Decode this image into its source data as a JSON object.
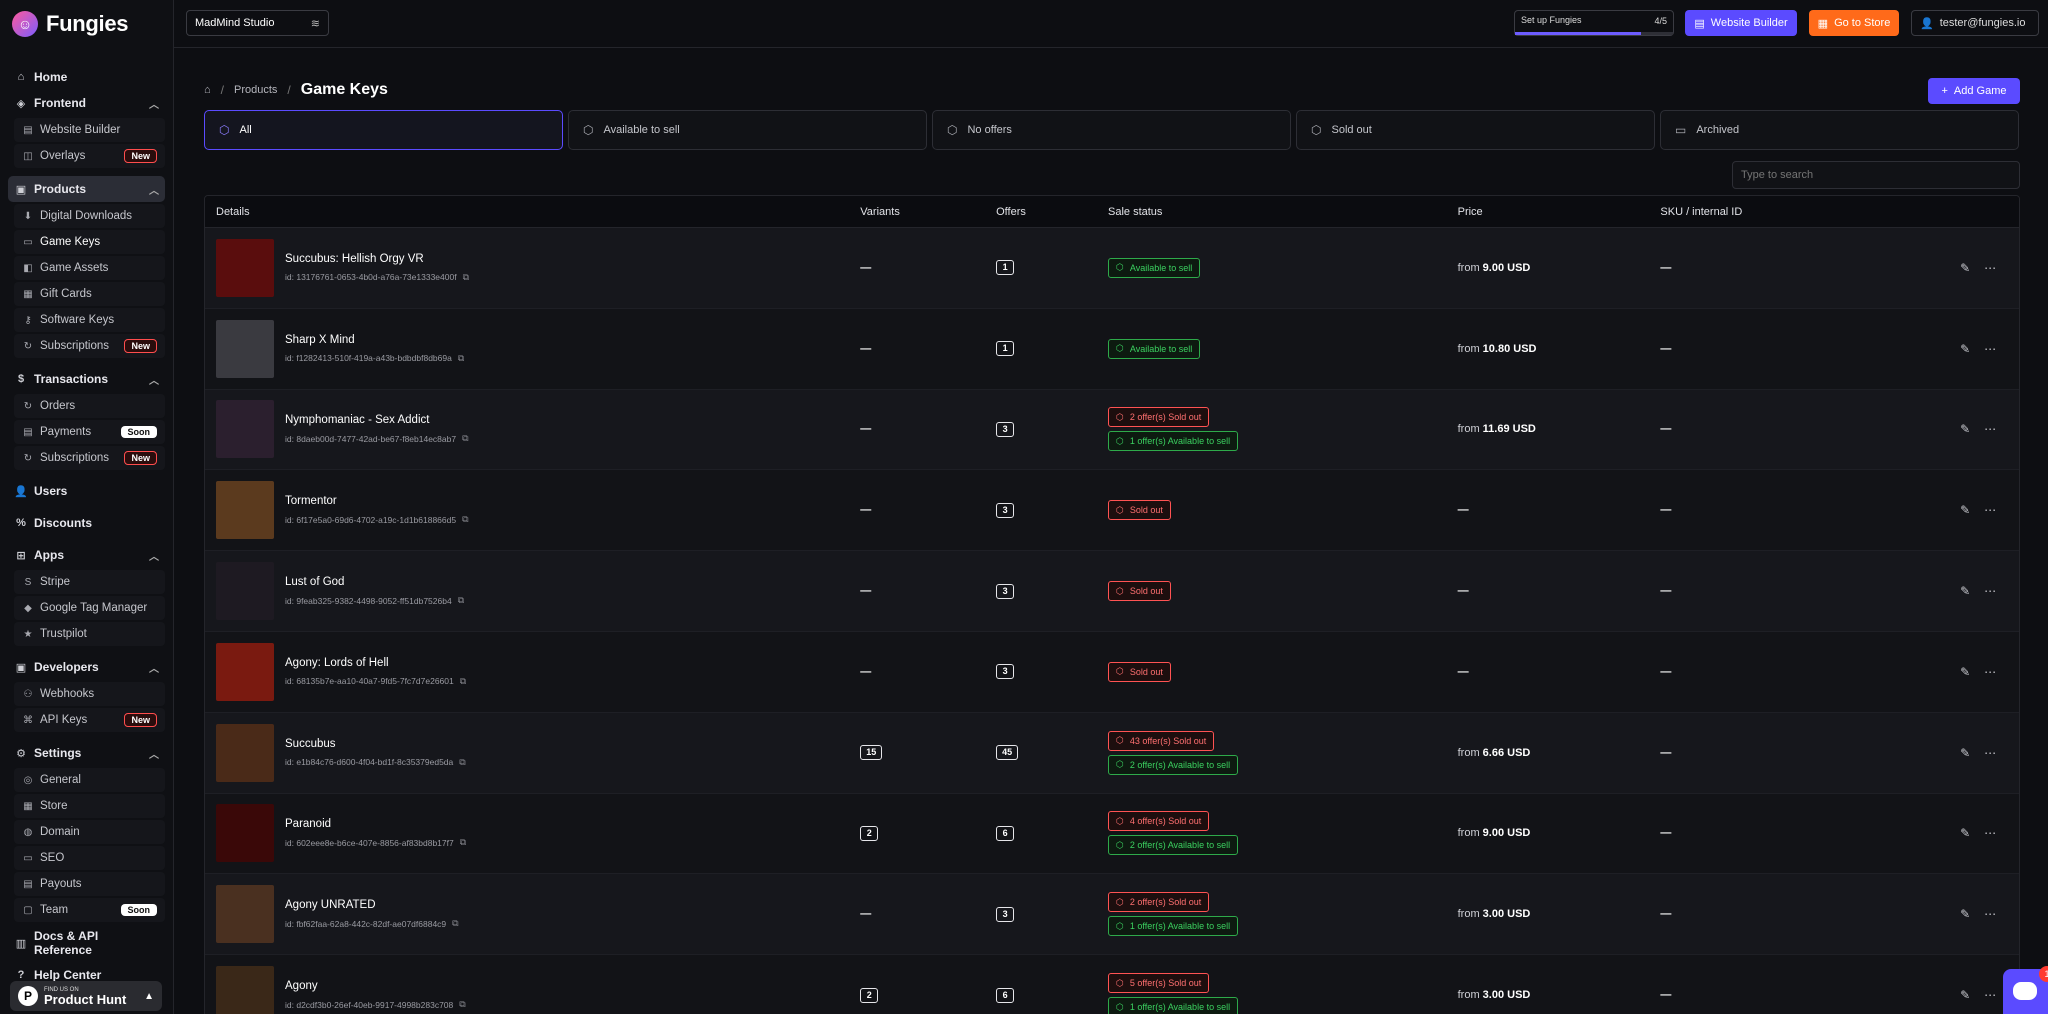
{
  "app": {
    "logo_text": "Fungies"
  },
  "sidebar": {
    "home": "Home",
    "frontend": {
      "label": "Frontend",
      "items": [
        {
          "label": "Website Builder"
        },
        {
          "label": "Overlays",
          "badge": "New"
        }
      ]
    },
    "products": {
      "label": "Products",
      "items": [
        {
          "label": "Digital Downloads"
        },
        {
          "label": "Game Keys"
        },
        {
          "label": "Game Assets"
        },
        {
          "label": "Gift Cards"
        },
        {
          "label": "Software Keys"
        },
        {
          "label": "Subscriptions",
          "badge": "New"
        }
      ]
    },
    "transactions": {
      "label": "Transactions",
      "items": [
        {
          "label": "Orders"
        },
        {
          "label": "Payments",
          "badge": "Soon"
        },
        {
          "label": "Subscriptions",
          "badge": "New"
        }
      ]
    },
    "users": "Users",
    "discounts": "Discounts",
    "apps": {
      "label": "Apps",
      "items": [
        {
          "label": "Stripe"
        },
        {
          "label": "Google Tag Manager"
        },
        {
          "label": "Trustpilot"
        }
      ]
    },
    "developers": {
      "label": "Developers",
      "items": [
        {
          "label": "Webhooks"
        },
        {
          "label": "API Keys",
          "badge": "New"
        }
      ]
    },
    "settings": {
      "label": "Settings",
      "items": [
        {
          "label": "General"
        },
        {
          "label": "Store"
        },
        {
          "label": "Domain"
        },
        {
          "label": "SEO"
        },
        {
          "label": "Payouts"
        },
        {
          "label": "Team",
          "badge": "Soon"
        }
      ]
    },
    "docs": "Docs & API Reference",
    "help": "Help Center",
    "product_hunt": {
      "small": "FIND US ON",
      "big": "Product Hunt"
    }
  },
  "topbar": {
    "studio": "MadMind Studio",
    "setup": {
      "label": "Set up Fungies",
      "count": "4/5",
      "progress": 0.8
    },
    "website_builder": "Website Builder",
    "go_to_store": "Go to Store",
    "user_email": "tester@fungies.io"
  },
  "breadcrumb": {
    "products": "Products",
    "current": "Game Keys"
  },
  "add_game": "Add Game",
  "filters": [
    {
      "label": "All",
      "active": true
    },
    {
      "label": "Available to sell"
    },
    {
      "label": "No offers"
    },
    {
      "label": "Sold out"
    },
    {
      "label": "Archived"
    }
  ],
  "search": {
    "placeholder": "Type to search"
  },
  "table": {
    "headers": {
      "details": "Details",
      "variants": "Variants",
      "offers": "Offers",
      "sale_status": "Sale status",
      "price": "Price",
      "sku": "SKU / internal ID"
    },
    "rows": [
      {
        "title": "Succubus: Hellish Orgy VR",
        "id": "id: 13176761-0653-4b0d-a76a-73e1333e400f",
        "variants": "—",
        "offers": "1",
        "status": [
          {
            "type": "green",
            "text": "Available to sell"
          }
        ],
        "price_prefix": "from",
        "price": "9.00 USD",
        "sku": "—",
        "thumb": "#5a0d0d"
      },
      {
        "title": "Sharp X Mind",
        "id": "id: f1282413-510f-419a-a43b-bdbdbf8db69a",
        "variants": "—",
        "offers": "1",
        "status": [
          {
            "type": "green",
            "text": "Available to sell"
          }
        ],
        "price_prefix": "from",
        "price": "10.80 USD",
        "sku": "—",
        "thumb": "#3a3a40"
      },
      {
        "title": "Nymphomaniac - Sex Addict",
        "id": "id: 8daeb00d-7477-42ad-be67-f8eb14ec8ab7",
        "variants": "—",
        "offers": "3",
        "status": [
          {
            "type": "red",
            "text": "2 offer(s) Sold out"
          },
          {
            "type": "green",
            "text": "1 offer(s) Available to sell"
          }
        ],
        "price_prefix": "from",
        "price": "11.69 USD",
        "sku": "—",
        "thumb": "#2b1f2e"
      },
      {
        "title": "Tormentor",
        "id": "id: 6f17e5a0-69d6-4702-a19c-1d1b618866d5",
        "variants": "—",
        "offers": "3",
        "status": [
          {
            "type": "red",
            "text": "Sold out"
          }
        ],
        "price_prefix": "",
        "price": "—",
        "sku": "—",
        "thumb": "#5b3a1e"
      },
      {
        "title": "Lust of God",
        "id": "id: 9feab325-9382-4498-9052-ff51db7526b4",
        "variants": "—",
        "offers": "3",
        "status": [
          {
            "type": "red",
            "text": "Sold out"
          }
        ],
        "price_prefix": "",
        "price": "—",
        "sku": "—",
        "thumb": "#1e1a22"
      },
      {
        "title": "Agony: Lords of Hell",
        "id": "id: 68135b7e-aa10-40a7-9fd5-7fc7d7e26601",
        "variants": "—",
        "offers": "3",
        "status": [
          {
            "type": "red",
            "text": "Sold out"
          }
        ],
        "price_prefix": "",
        "price": "—",
        "sku": "—",
        "thumb": "#7a1a10"
      },
      {
        "title": "Succubus",
        "id": "id: e1b84c76-d600-4f04-bd1f-8c35379ed5da",
        "variants": "15",
        "offers": "45",
        "status": [
          {
            "type": "red",
            "text": "43 offer(s) Sold out"
          },
          {
            "type": "green",
            "text": "2 offer(s) Available to sell"
          }
        ],
        "price_prefix": "from",
        "price": "6.66 USD",
        "sku": "—",
        "thumb": "#4a2a18"
      },
      {
        "title": "Paranoid",
        "id": "id: 602eee8e-b6ce-407e-8856-af83bd8b17f7",
        "variants": "2",
        "offers": "6",
        "status": [
          {
            "type": "red",
            "text": "4 offer(s) Sold out"
          },
          {
            "type": "green",
            "text": "2 offer(s) Available to sell"
          }
        ],
        "price_prefix": "from",
        "price": "9.00 USD",
        "sku": "—",
        "thumb": "#3a0808"
      },
      {
        "title": "Agony UNRATED",
        "id": "id: fbf62faa-62a8-442c-82df-ae07df6884c9",
        "variants": "—",
        "offers": "3",
        "status": [
          {
            "type": "red",
            "text": "2 offer(s) Sold out"
          },
          {
            "type": "green",
            "text": "1 offer(s) Available to sell"
          }
        ],
        "price_prefix": "from",
        "price": "3.00 USD",
        "sku": "—",
        "thumb": "#4a3020"
      },
      {
        "title": "Agony",
        "id": "id: d2cdf3b0-26ef-40eb-9917-4998b283c708",
        "variants": "2",
        "offers": "6",
        "status": [
          {
            "type": "red",
            "text": "5 offer(s) Sold out"
          },
          {
            "type": "green",
            "text": "1 offer(s) Available to sell"
          }
        ],
        "price_prefix": "from",
        "price": "3.00 USD",
        "sku": "—",
        "thumb": "#3a2818"
      }
    ]
  },
  "chat": {
    "badge": "1"
  },
  "colors": {
    "accent": "#5b4bff",
    "store": "#ff6a1a",
    "green": "#3bd160",
    "red": "#ff7070"
  }
}
